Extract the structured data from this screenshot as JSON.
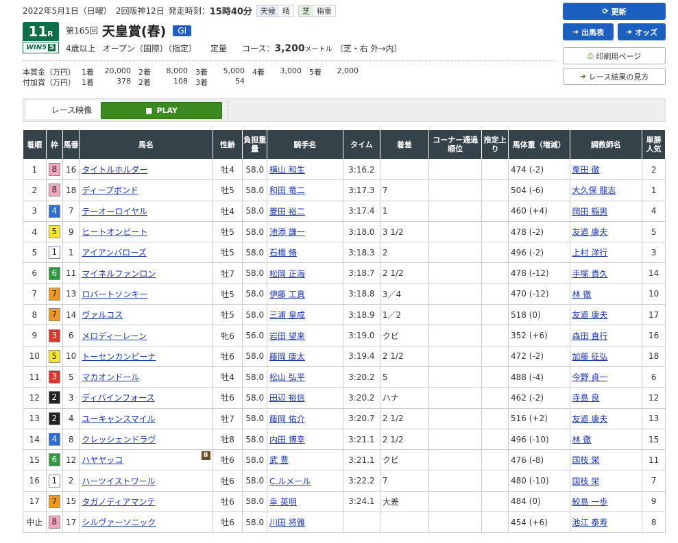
{
  "header": {
    "date": "2022年5月1日（日曜）",
    "meeting": "2回阪神12日",
    "post_label": "発走時刻：",
    "post_time": "15時40分",
    "weather_label": "天候",
    "weather": "晴",
    "turf_label": "芝",
    "turf": "稍重"
  },
  "race": {
    "no": "11",
    "r": "R",
    "wins": "WIN5",
    "wins_no": "5",
    "kai": "第165回",
    "name": "天皇賞(春)",
    "grade": "GI",
    "cond1": "4歳以上",
    "cond2": "オープン（国際）（指定）",
    "cond3": "定量",
    "course_label": "コース：",
    "distance": "3,200",
    "unit": "メートル",
    "course_detail": "（芝・右 外→内）"
  },
  "prize": {
    "main_label": "本賞金（万円）",
    "main": [
      [
        "1着",
        "20,000"
      ],
      [
        "2着",
        "8,000"
      ],
      [
        "3着",
        "5,000"
      ],
      [
        "4着",
        "3,000"
      ],
      [
        "5着",
        "2,000"
      ]
    ],
    "add_label": "付加賞（万円）",
    "add": [
      [
        "1着",
        "378"
      ],
      [
        "2着",
        "108"
      ],
      [
        "3着",
        "54"
      ]
    ]
  },
  "buttons": {
    "refresh": "更新",
    "entries": "出馬表",
    "odds": "オッズ",
    "print": "印刷用ページ",
    "guide": "レース結果の見方"
  },
  "video": {
    "label": "レース映像",
    "play": "PLAY"
  },
  "columns": [
    "着順",
    "枠",
    "馬番",
    "馬名",
    "性齢",
    "負担重量",
    "騎手名",
    "タイム",
    "着差",
    "コーナー通過順位",
    "推定上り",
    "馬体重（増減）",
    "調教師名",
    "単勝人気"
  ],
  "rows": [
    [
      "1",
      "8",
      "16",
      "タイトルホルダー",
      "牡4",
      "58.0",
      "横山 和生",
      "3:16.2",
      "",
      "",
      "",
      "474 (-2)",
      "栗田 徹",
      "2"
    ],
    [
      "2",
      "8",
      "18",
      "ディープボンド",
      "牡5",
      "58.0",
      "和田 竜二",
      "3:17.3",
      "7",
      "",
      "",
      "504 (-6)",
      "大久保 龍志",
      "1"
    ],
    [
      "3",
      "4",
      "7",
      "テーオーロイヤル",
      "牡4",
      "58.0",
      "菱田 裕二",
      "3:17.4",
      "1",
      "",
      "",
      "460 (+4)",
      "岡田 稲男",
      "4"
    ],
    [
      "4",
      "5",
      "9",
      "ヒートオンビート",
      "牡5",
      "58.0",
      "池添 謙一",
      "3:18.0",
      "3 1/2",
      "",
      "",
      "478 (-2)",
      "友道 康夫",
      "5"
    ],
    [
      "5",
      "1",
      "1",
      "アイアンバローズ",
      "牡5",
      "58.0",
      "石橋 脩",
      "3:18.3",
      "2",
      "",
      "",
      "496 (-2)",
      "上村 洋行",
      "3"
    ],
    [
      "6",
      "6",
      "11",
      "マイネルファンロン",
      "牡7",
      "58.0",
      "松岡 正海",
      "3:18.7",
      "2 1/2",
      "",
      "",
      "478 (-12)",
      "手塚 貴久",
      "14"
    ],
    [
      "7",
      "7",
      "13",
      "ロバートソンキー",
      "牡5",
      "58.0",
      "伊藤 工真",
      "3:18.8",
      "3／4",
      "",
      "",
      "470 (-12)",
      "林 徹",
      "10"
    ],
    [
      "8",
      "7",
      "14",
      "ヴァルコス",
      "牡5",
      "58.0",
      "三浦 皇成",
      "3:18.9",
      "1／2",
      "",
      "",
      "518 (0)",
      "友道 康夫",
      "17"
    ],
    [
      "9",
      "3",
      "6",
      "メロディーレーン",
      "牝6",
      "56.0",
      "岩田 望来",
      "3:19.0",
      "クビ",
      "",
      "",
      "352 (+6)",
      "森田 直行",
      "16"
    ],
    [
      "10",
      "5",
      "10",
      "トーセンカンビーナ",
      "牡6",
      "58.0",
      "藤岡 康太",
      "3:19.4",
      "2 1/2",
      "",
      "",
      "472 (-2)",
      "加藤 征弘",
      "18"
    ],
    [
      "11",
      "3",
      "5",
      "マカオンドール",
      "牡4",
      "58.0",
      "松山 弘平",
      "3:20.2",
      "5",
      "",
      "",
      "488 (-4)",
      "今野 貞一",
      "6"
    ],
    [
      "12",
      "2",
      "3",
      "ディバインフォース",
      "牡6",
      "58.0",
      "田辺 裕信",
      "3:20.2",
      "ハナ",
      "",
      "",
      "462 (-2)",
      "寺島 良",
      "12"
    ],
    [
      "13",
      "2",
      "4",
      "ユーキャンスマイル",
      "牡7",
      "58.0",
      "藤岡 佑介",
      "3:20.7",
      "2 1/2",
      "",
      "",
      "516 (+2)",
      "友道 康夫",
      "13"
    ],
    [
      "14",
      "4",
      "8",
      "クレッシェンドラヴ",
      "牡8",
      "58.0",
      "内田 博幸",
      "3:21.1",
      "2 1/2",
      "",
      "",
      "496 (-10)",
      "林 徹",
      "15"
    ],
    [
      "15",
      "6",
      "12",
      "ハヤヤッコ",
      "牡6",
      "58.0",
      "武 豊",
      "3:21.1",
      "クビ",
      "",
      "",
      "476 (-8)",
      "国枝 栄",
      "11"
    ],
    [
      "16",
      "1",
      "2",
      "ハーツイストワール",
      "牡6",
      "58.0",
      "C.ルメール",
      "3:22.2",
      "7",
      "",
      "",
      "480 (-10)",
      "国枝 栄",
      "7"
    ],
    [
      "17",
      "7",
      "15",
      "タガノディアマンテ",
      "牡6",
      "58.0",
      "幸 英明",
      "3:24.1",
      "大差",
      "",
      "",
      "484 (0)",
      "鮫島 一歩",
      "9"
    ],
    [
      "中止",
      "8",
      "17",
      "シルヴァーソニック",
      "牡6",
      "58.0",
      "川田 将雅",
      "",
      "",
      "",
      "",
      "454 (+6)",
      "池江 泰寿",
      "8"
    ]
  ],
  "blinker_mark": "B",
  "waku_colors": {
    "1": [
      "#ffffff",
      "#222222"
    ],
    "2": [
      "#222222",
      "#ffffff"
    ],
    "3": [
      "#e0332a",
      "#ffffff"
    ],
    "4": [
      "#2a6fd6",
      "#ffffff"
    ],
    "5": [
      "#ffe628",
      "#222222"
    ],
    "6": [
      "#2c9b3f",
      "#ffffff"
    ],
    "7": [
      "#f39a1c",
      "#222222"
    ],
    "8": [
      "#f5a6bd",
      "#222222"
    ]
  }
}
